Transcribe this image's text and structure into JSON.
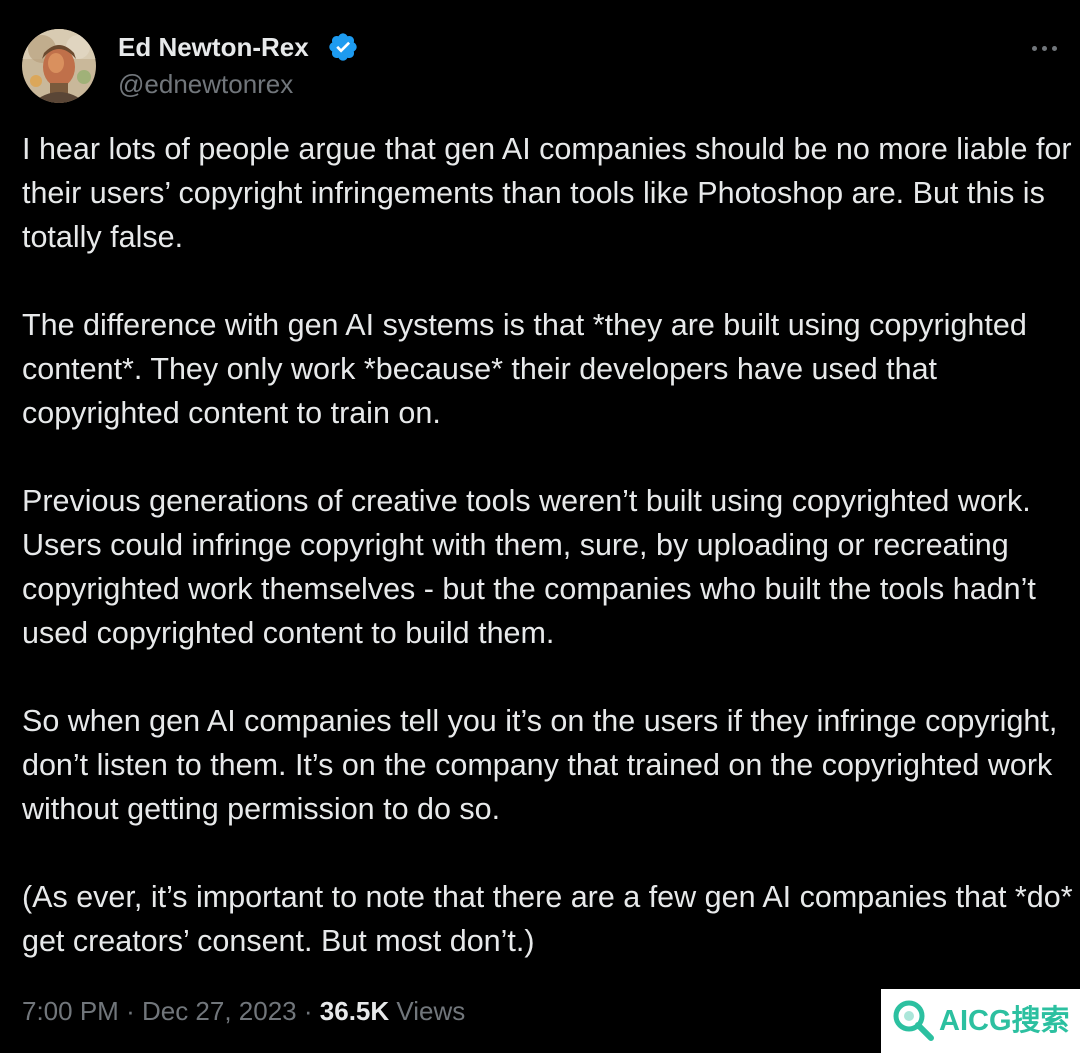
{
  "author": {
    "display_name": "Ed Newton-Rex",
    "handle": "@ednewtonrex",
    "verified": true,
    "avatar_icon": "avatar-photo",
    "verified_color": "#1d9bf0"
  },
  "more_icon": "more-horizontal-icon",
  "tweet": {
    "paragraphs": [
      "I hear lots of people argue that gen AI companies should be no more liable for their users’ copyright infringements than tools like Photoshop are. But this is totally false.",
      "The difference with gen AI systems is that *they are built using copyrighted content*. They only work *because* their developers have used that copyrighted content to train on.",
      "Previous generations of creative tools weren’t built using copyrighted work. Users could infringe copyright with them, sure, by uploading or recreating copyrighted work themselves - but the companies who built the tools hadn’t used copyrighted content to build them.",
      "So when gen AI companies tell you it’s on the users if they infringe copyright, don’t listen to them. It’s on the company that trained on the copyrighted work without getting permission to do so.",
      "(As ever, it’s important to note that there are a few gen AI companies that *do* get creators’ consent. But most don’t.)"
    ]
  },
  "meta": {
    "time": "7:00 PM",
    "separator": "·",
    "date": "Dec 27, 2023",
    "views_count": "36.5K",
    "views_label": "Views"
  },
  "watermark": {
    "text": "AICG搜索",
    "color": "#2cc0a0"
  },
  "colors": {
    "background": "#000000",
    "text_primary": "#e7e9ea",
    "text_secondary": "#71767b"
  }
}
